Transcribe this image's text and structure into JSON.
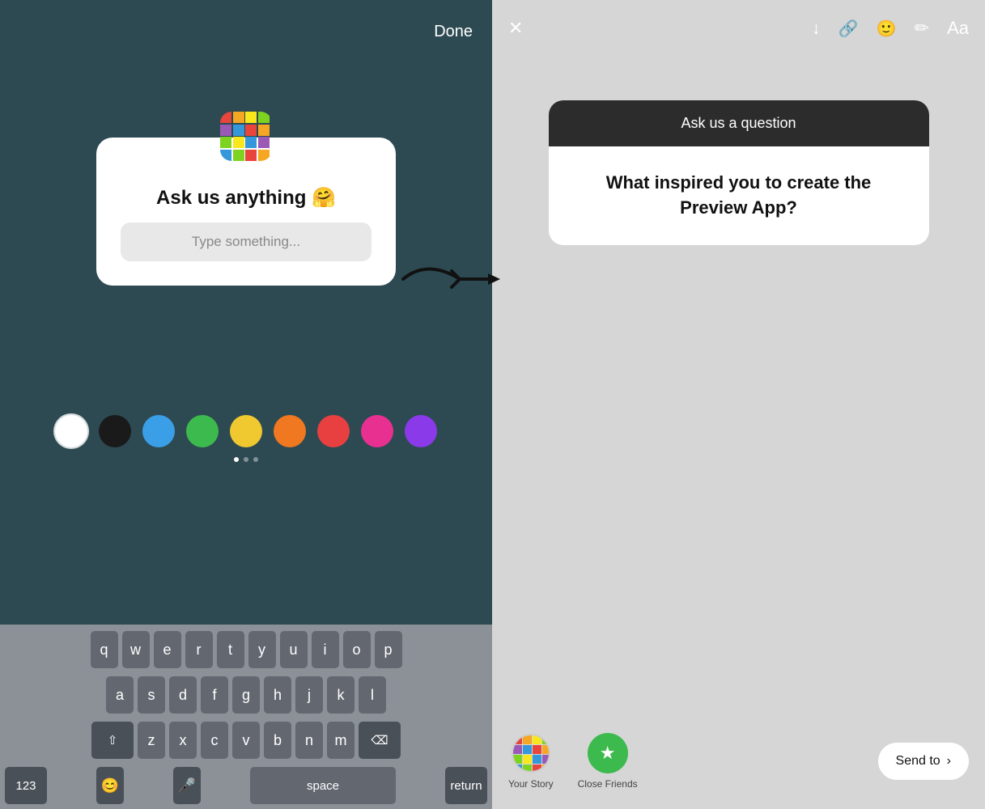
{
  "left": {
    "done_label": "Done",
    "sticker": {
      "title": "Ask us anything 🤗",
      "placeholder": "Type something..."
    },
    "colors": [
      {
        "name": "white",
        "hex": "#ffffff"
      },
      {
        "name": "black",
        "hex": "#1a1a1a"
      },
      {
        "name": "blue",
        "hex": "#3b9fe8"
      },
      {
        "name": "green",
        "hex": "#3dba4e"
      },
      {
        "name": "yellow",
        "hex": "#f0c930"
      },
      {
        "name": "orange",
        "hex": "#f07820"
      },
      {
        "name": "red",
        "hex": "#e84040"
      },
      {
        "name": "pink",
        "hex": "#e83090"
      },
      {
        "name": "purple",
        "hex": "#8a3ae8"
      }
    ],
    "keyboard": {
      "rows": [
        [
          "q",
          "w",
          "e",
          "r",
          "t",
          "y",
          "u",
          "i",
          "o",
          "p"
        ],
        [
          "a",
          "s",
          "d",
          "f",
          "g",
          "h",
          "j",
          "k",
          "l"
        ],
        [
          "z",
          "x",
          "c",
          "v",
          "b",
          "n",
          "m"
        ]
      ],
      "special_keys": {
        "numbers": "123",
        "emoji": "😊",
        "mic": "🎤",
        "space": "space",
        "return": "return",
        "shift": "⇧",
        "backspace": "⌫"
      }
    }
  },
  "right": {
    "toolbar": {
      "close": "✕",
      "download": "↓",
      "link": "🔗",
      "sticker": "😊",
      "draw": "✏",
      "text": "Aa"
    },
    "question_card": {
      "header": "Ask us a question",
      "body": "What inspired you to create the Preview App?"
    },
    "bottom": {
      "your_story_label": "Your Story",
      "close_friends_label": "Close Friends",
      "send_to_label": "Send to"
    }
  }
}
